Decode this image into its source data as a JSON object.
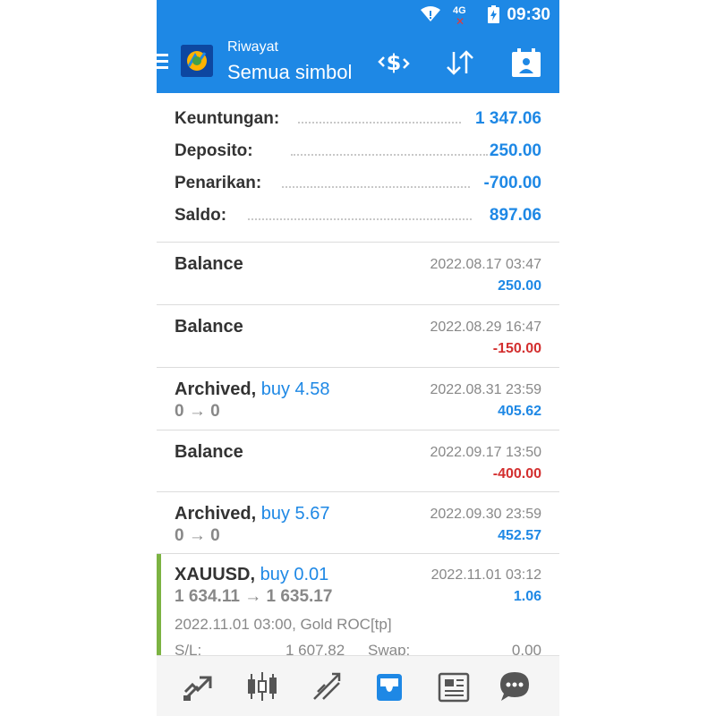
{
  "status_bar": {
    "network": "4G",
    "time": "09:30"
  },
  "app_bar": {
    "subtitle": "Riwayat",
    "title": "Semua simbol",
    "color": "#1e88e5"
  },
  "summary": [
    {
      "label": "Keuntungan:",
      "value": "1 347.06"
    },
    {
      "label": "Deposito:",
      "value": "250.00"
    },
    {
      "label": "Penarikan:",
      "value": "-700.00"
    },
    {
      "label": "Saldo:",
      "value": "897.06"
    }
  ],
  "history": [
    {
      "title": "Balance",
      "buy": "",
      "sub": "",
      "date": "2022.08.17 03:47",
      "amount": "250.00",
      "sign": "pos"
    },
    {
      "title": "Balance",
      "buy": "",
      "sub": "",
      "date": "2022.08.29 16:47",
      "amount": "-150.00",
      "sign": "neg"
    },
    {
      "title": "Archived,",
      "buy": "buy 4.58",
      "sub": "0 → 0",
      "date": "2022.08.31 23:59",
      "amount": "405.62",
      "sign": "pos"
    },
    {
      "title": "Balance",
      "buy": "",
      "sub": "",
      "date": "2022.09.17 13:50",
      "amount": "-400.00",
      "sign": "neg"
    },
    {
      "title": "Archived,",
      "buy": "buy 5.67",
      "sub": "0 → 0",
      "date": "2022.09.30 23:59",
      "amount": "452.57",
      "sign": "pos"
    }
  ],
  "open_position": {
    "symbol": "XAUUSD,",
    "buy": "buy 0.01",
    "prices": "1 634.11 → 1 635.17",
    "date": "2022.11.01 03:12",
    "amount": "1.06",
    "comment": "2022.11.01 03:00, Gold ROC[tp]",
    "sl_label": "S/L:",
    "sl_value": "1 607.82",
    "swap_label": "Swap:",
    "swap_value": "0.00"
  },
  "bottom_nav": [
    {
      "icon": "quotes-icon"
    },
    {
      "icon": "charts-icon"
    },
    {
      "icon": "trade-icon"
    },
    {
      "icon": "history-icon",
      "active": true
    },
    {
      "icon": "journal-icon"
    },
    {
      "icon": "chat-icon"
    }
  ],
  "colors": {
    "accent": "#1e88e5",
    "negative": "#d32f2f",
    "open_marker": "#7cb342"
  }
}
